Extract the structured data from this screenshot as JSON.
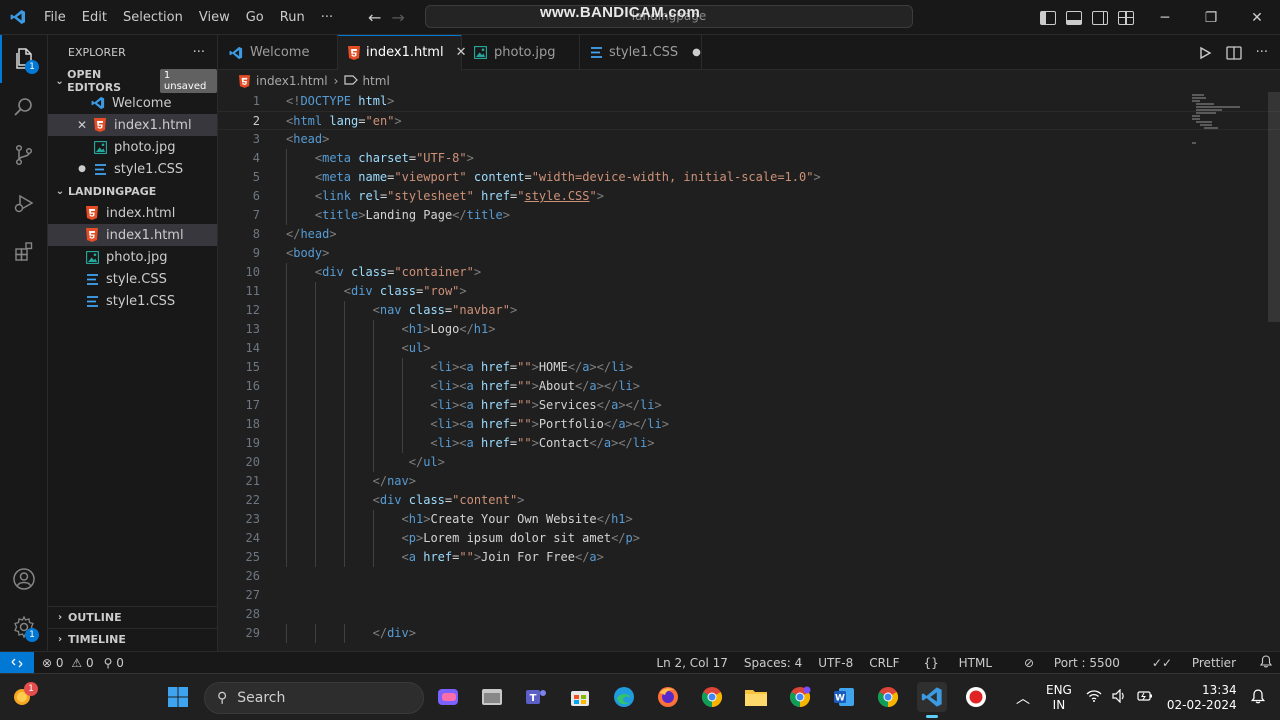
{
  "titlebar": {
    "menu": [
      "File",
      "Edit",
      "Selection",
      "View",
      "Go",
      "Run",
      "···"
    ],
    "command_center": "landingpage",
    "watermark": "www.BANDICAM.com",
    "minimize": "─",
    "restore": "❐",
    "close": "✕"
  },
  "activitybar": {
    "explorer_badge": "1",
    "accounts": "accounts-icon",
    "settings_badge": "1"
  },
  "sidebar": {
    "title": "EXPLORER",
    "more": "···",
    "open_editors": {
      "label": "OPEN EDITORS",
      "badge": "1 unsaved",
      "items": [
        {
          "name": "Welcome",
          "type": "vscode",
          "mark": ""
        },
        {
          "name": "index1.html",
          "type": "html",
          "mark": "✕"
        },
        {
          "name": "photo.jpg",
          "type": "jpg",
          "mark": ""
        },
        {
          "name": "style1.CSS",
          "type": "css",
          "mark": "●"
        }
      ]
    },
    "folder": {
      "label": "LANDINGPAGE",
      "items": [
        {
          "name": "index.html",
          "type": "html"
        },
        {
          "name": "index1.html",
          "type": "html"
        },
        {
          "name": "photo.jpg",
          "type": "jpg"
        },
        {
          "name": "style.CSS",
          "type": "css"
        },
        {
          "name": "style1.CSS",
          "type": "css"
        }
      ]
    },
    "outline": "OUTLINE",
    "timeline": "TIMELINE"
  },
  "tabs": [
    {
      "label": "Welcome",
      "type": "vscode",
      "tail": ""
    },
    {
      "label": "index1.html",
      "type": "html",
      "tail": "✕"
    },
    {
      "label": "photo.jpg",
      "type": "jpg",
      "tail": ""
    },
    {
      "label": "style1.CSS",
      "type": "css",
      "tail": "●"
    }
  ],
  "breadcrumb": {
    "file": "index1.html",
    "sep": "›",
    "symbol": "html"
  },
  "editor": {
    "lines": [
      {
        "n": "1",
        "indent": 0,
        "tokens": [
          [
            "tg",
            "<!"
          ],
          [
            "tn",
            "DOCTYPE"
          ],
          [
            "tx",
            " "
          ],
          [
            "at",
            "html"
          ],
          [
            "tg",
            ">"
          ]
        ]
      },
      {
        "n": "2",
        "indent": 0,
        "tokens": [
          [
            "tg",
            "<"
          ],
          [
            "tn",
            "html"
          ],
          [
            "tx",
            " "
          ],
          [
            "at",
            "lang"
          ],
          [
            "tx",
            "="
          ],
          [
            "st",
            "\"en\""
          ],
          [
            "tg",
            ">"
          ]
        ]
      },
      {
        "n": "3",
        "indent": 0,
        "tokens": [
          [
            "tg",
            "<"
          ],
          [
            "tn",
            "head"
          ],
          [
            "tg",
            ">"
          ]
        ]
      },
      {
        "n": "4",
        "indent": 1,
        "tokens": [
          [
            "tg",
            "<"
          ],
          [
            "tn",
            "meta"
          ],
          [
            "tx",
            " "
          ],
          [
            "at",
            "charset"
          ],
          [
            "tx",
            "="
          ],
          [
            "st",
            "\"UTF-8\""
          ],
          [
            "tg",
            ">"
          ]
        ]
      },
      {
        "n": "5",
        "indent": 1,
        "tokens": [
          [
            "tg",
            "<"
          ],
          [
            "tn",
            "meta"
          ],
          [
            "tx",
            " "
          ],
          [
            "at",
            "name"
          ],
          [
            "tx",
            "="
          ],
          [
            "st",
            "\"viewport\""
          ],
          [
            "tx",
            " "
          ],
          [
            "at",
            "content"
          ],
          [
            "tx",
            "="
          ],
          [
            "st",
            "\"width=device-width, initial-scale=1.0\""
          ],
          [
            "tg",
            ">"
          ]
        ]
      },
      {
        "n": "6",
        "indent": 1,
        "tokens": [
          [
            "tg",
            "<"
          ],
          [
            "tn",
            "link"
          ],
          [
            "tx",
            " "
          ],
          [
            "at",
            "rel"
          ],
          [
            "tx",
            "="
          ],
          [
            "st",
            "\"stylesheet\""
          ],
          [
            "tx",
            " "
          ],
          [
            "at",
            "href"
          ],
          [
            "tx",
            "="
          ],
          [
            "st",
            "\""
          ],
          [
            "ul",
            "style.CSS"
          ],
          [
            "st",
            "\""
          ],
          [
            "tg",
            ">"
          ]
        ]
      },
      {
        "n": "7",
        "indent": 1,
        "tokens": [
          [
            "tg",
            "<"
          ],
          [
            "tn",
            "title"
          ],
          [
            "tg",
            ">"
          ],
          [
            "tx",
            "Landing Page"
          ],
          [
            "tg",
            "</"
          ],
          [
            "tn",
            "title"
          ],
          [
            "tg",
            ">"
          ]
        ]
      },
      {
        "n": "8",
        "indent": 0,
        "tokens": [
          [
            "tg",
            "</"
          ],
          [
            "tn",
            "head"
          ],
          [
            "tg",
            ">"
          ]
        ]
      },
      {
        "n": "9",
        "indent": 0,
        "tokens": [
          [
            "tg",
            "<"
          ],
          [
            "tn",
            "body"
          ],
          [
            "tg",
            ">"
          ]
        ]
      },
      {
        "n": "10",
        "indent": 1,
        "tokens": [
          [
            "tg",
            "<"
          ],
          [
            "tn",
            "div"
          ],
          [
            "tx",
            " "
          ],
          [
            "at",
            "class"
          ],
          [
            "tx",
            "="
          ],
          [
            "st",
            "\"container\""
          ],
          [
            "tg",
            ">"
          ]
        ]
      },
      {
        "n": "11",
        "indent": 2,
        "tokens": [
          [
            "tg",
            "<"
          ],
          [
            "tn",
            "div"
          ],
          [
            "tx",
            " "
          ],
          [
            "at",
            "class"
          ],
          [
            "tx",
            "="
          ],
          [
            "st",
            "\"row\""
          ],
          [
            "tg",
            ">"
          ]
        ]
      },
      {
        "n": "12",
        "indent": 3,
        "tokens": [
          [
            "tg",
            "<"
          ],
          [
            "tn",
            "nav"
          ],
          [
            "tx",
            " "
          ],
          [
            "at",
            "class"
          ],
          [
            "tx",
            "="
          ],
          [
            "st",
            "\"navbar\""
          ],
          [
            "tg",
            ">"
          ]
        ]
      },
      {
        "n": "13",
        "indent": 4,
        "tokens": [
          [
            "tg",
            "<"
          ],
          [
            "tn",
            "h1"
          ],
          [
            "tg",
            ">"
          ],
          [
            "tx",
            "Logo"
          ],
          [
            "tg",
            "</"
          ],
          [
            "tn",
            "h1"
          ],
          [
            "tg",
            ">"
          ]
        ]
      },
      {
        "n": "14",
        "indent": 4,
        "tokens": [
          [
            "tg",
            "<"
          ],
          [
            "tn",
            "ul"
          ],
          [
            "tg",
            ">"
          ]
        ]
      },
      {
        "n": "15",
        "indent": 5,
        "tokens": [
          [
            "tg",
            "<"
          ],
          [
            "tn",
            "li"
          ],
          [
            "tg",
            "><"
          ],
          [
            "tn",
            "a"
          ],
          [
            "tx",
            " "
          ],
          [
            "at",
            "href"
          ],
          [
            "tx",
            "="
          ],
          [
            "st",
            "\"\""
          ],
          [
            "tg",
            ">"
          ],
          [
            "tx",
            "HOME"
          ],
          [
            "tg",
            "</"
          ],
          [
            "tn",
            "a"
          ],
          [
            "tg",
            "></"
          ],
          [
            "tn",
            "li"
          ],
          [
            "tg",
            ">"
          ]
        ]
      },
      {
        "n": "16",
        "indent": 5,
        "tokens": [
          [
            "tg",
            "<"
          ],
          [
            "tn",
            "li"
          ],
          [
            "tg",
            "><"
          ],
          [
            "tn",
            "a"
          ],
          [
            "tx",
            " "
          ],
          [
            "at",
            "href"
          ],
          [
            "tx",
            "="
          ],
          [
            "st",
            "\"\""
          ],
          [
            "tg",
            ">"
          ],
          [
            "tx",
            "About"
          ],
          [
            "tg",
            "</"
          ],
          [
            "tn",
            "a"
          ],
          [
            "tg",
            "></"
          ],
          [
            "tn",
            "li"
          ],
          [
            "tg",
            ">"
          ]
        ]
      },
      {
        "n": "17",
        "indent": 5,
        "tokens": [
          [
            "tg",
            "<"
          ],
          [
            "tn",
            "li"
          ],
          [
            "tg",
            "><"
          ],
          [
            "tn",
            "a"
          ],
          [
            "tx",
            " "
          ],
          [
            "at",
            "href"
          ],
          [
            "tx",
            "="
          ],
          [
            "st",
            "\"\""
          ],
          [
            "tg",
            ">"
          ],
          [
            "tx",
            "Services"
          ],
          [
            "tg",
            "</"
          ],
          [
            "tn",
            "a"
          ],
          [
            "tg",
            "></"
          ],
          [
            "tn",
            "li"
          ],
          [
            "tg",
            ">"
          ]
        ]
      },
      {
        "n": "18",
        "indent": 5,
        "tokens": [
          [
            "tg",
            "<"
          ],
          [
            "tn",
            "li"
          ],
          [
            "tg",
            "><"
          ],
          [
            "tn",
            "a"
          ],
          [
            "tx",
            " "
          ],
          [
            "at",
            "href"
          ],
          [
            "tx",
            "="
          ],
          [
            "st",
            "\"\""
          ],
          [
            "tg",
            ">"
          ],
          [
            "tx",
            "Portfolio"
          ],
          [
            "tg",
            "</"
          ],
          [
            "tn",
            "a"
          ],
          [
            "tg",
            "></"
          ],
          [
            "tn",
            "li"
          ],
          [
            "tg",
            ">"
          ]
        ]
      },
      {
        "n": "19",
        "indent": 5,
        "tokens": [
          [
            "tg",
            "<"
          ],
          [
            "tn",
            "li"
          ],
          [
            "tg",
            "><"
          ],
          [
            "tn",
            "a"
          ],
          [
            "tx",
            " "
          ],
          [
            "at",
            "href"
          ],
          [
            "tx",
            "="
          ],
          [
            "st",
            "\"\""
          ],
          [
            "tg",
            ">"
          ],
          [
            "tx",
            "Contact"
          ],
          [
            "tg",
            "</"
          ],
          [
            "tn",
            "a"
          ],
          [
            "tg",
            "></"
          ],
          [
            "tn",
            "li"
          ],
          [
            "tg",
            ">"
          ]
        ]
      },
      {
        "n": "20",
        "indent": 4,
        "tokens": [
          [
            "tx",
            " "
          ],
          [
            "tg",
            "</"
          ],
          [
            "tn",
            "ul"
          ],
          [
            "tg",
            ">"
          ]
        ]
      },
      {
        "n": "21",
        "indent": 3,
        "tokens": [
          [
            "tg",
            "</"
          ],
          [
            "tn",
            "nav"
          ],
          [
            "tg",
            ">"
          ]
        ]
      },
      {
        "n": "22",
        "indent": 3,
        "tokens": [
          [
            "tg",
            "<"
          ],
          [
            "tn",
            "div"
          ],
          [
            "tx",
            " "
          ],
          [
            "at",
            "class"
          ],
          [
            "tx",
            "="
          ],
          [
            "st",
            "\"content\""
          ],
          [
            "tg",
            ">"
          ]
        ]
      },
      {
        "n": "23",
        "indent": 4,
        "tokens": [
          [
            "tg",
            "<"
          ],
          [
            "tn",
            "h1"
          ],
          [
            "tg",
            ">"
          ],
          [
            "tx",
            "Create Your Own Website"
          ],
          [
            "tg",
            "</"
          ],
          [
            "tn",
            "h1"
          ],
          [
            "tg",
            ">"
          ]
        ]
      },
      {
        "n": "24",
        "indent": 4,
        "tokens": [
          [
            "tg",
            "<"
          ],
          [
            "tn",
            "p"
          ],
          [
            "tg",
            ">"
          ],
          [
            "tx",
            "Lorem ipsum dolor sit amet"
          ],
          [
            "tg",
            "</"
          ],
          [
            "tn",
            "p"
          ],
          [
            "tg",
            ">"
          ]
        ]
      },
      {
        "n": "25",
        "indent": 4,
        "tokens": [
          [
            "tg",
            "<"
          ],
          [
            "tn",
            "a"
          ],
          [
            "tx",
            " "
          ],
          [
            "at",
            "href"
          ],
          [
            "tx",
            "="
          ],
          [
            "st",
            "\"\""
          ],
          [
            "tg",
            ">"
          ],
          [
            "tx",
            "Join For Free"
          ],
          [
            "tg",
            "</"
          ],
          [
            "tn",
            "a"
          ],
          [
            "tg",
            ">"
          ]
        ]
      },
      {
        "n": "26",
        "indent": 0,
        "tokens": []
      },
      {
        "n": "27",
        "indent": 0,
        "tokens": []
      },
      {
        "n": "28",
        "indent": 0,
        "tokens": []
      },
      {
        "n": "29",
        "indent": 3,
        "tokens": [
          [
            "tg",
            "</"
          ],
          [
            "tn",
            "div"
          ],
          [
            "tg",
            ">"
          ]
        ]
      }
    ]
  },
  "statusbar": {
    "errors": "0",
    "warnings": "0",
    "ports": "0",
    "position": "Ln 2, Col 17",
    "spaces": "Spaces: 4",
    "encoding": "UTF-8",
    "eol": "CRLF",
    "language": "HTML",
    "port": "Port : 5500",
    "formatter": "Prettier"
  },
  "taskbar": {
    "search": "Search",
    "lang_top": "ENG",
    "lang_bottom": "IN",
    "time": "13:34",
    "date": "02-02-2024",
    "weather_badge": "1"
  },
  "colors": {
    "accent": "#0078d4",
    "editor_bg": "#1f1f1f",
    "chrome_bg": "#181818"
  }
}
